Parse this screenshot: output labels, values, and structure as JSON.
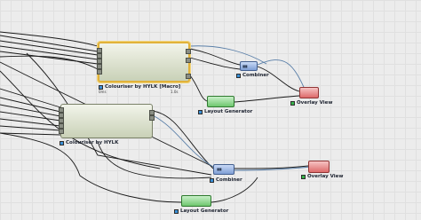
{
  "nodes": {
    "colouriser_macro": {
      "label": "Colouriser by HYLK [Macro]",
      "meta_left": "0ms",
      "meta_right": "1.0s"
    },
    "colouriser": {
      "label": "Colouriser by HYLK"
    },
    "combiner_top": {
      "label": "Combiner"
    },
    "combiner_bottom": {
      "label": "Combiner"
    },
    "layout_top": {
      "label": "Layout Generator"
    },
    "layout_bottom": {
      "label": "Layout Generator"
    },
    "overlay_top": {
      "label": "Overlay View"
    },
    "overlay_bottom": {
      "label": "Overlay View"
    }
  },
  "colors": {
    "canvas": "#ececec",
    "selection": "#e1b23a",
    "wire_dark": "#1a1a1a",
    "wire_blue": "#5a7fa8",
    "combiner": "#7f9fd5",
    "layout": "#6fc76f",
    "overlay": "#dd6a6a"
  }
}
